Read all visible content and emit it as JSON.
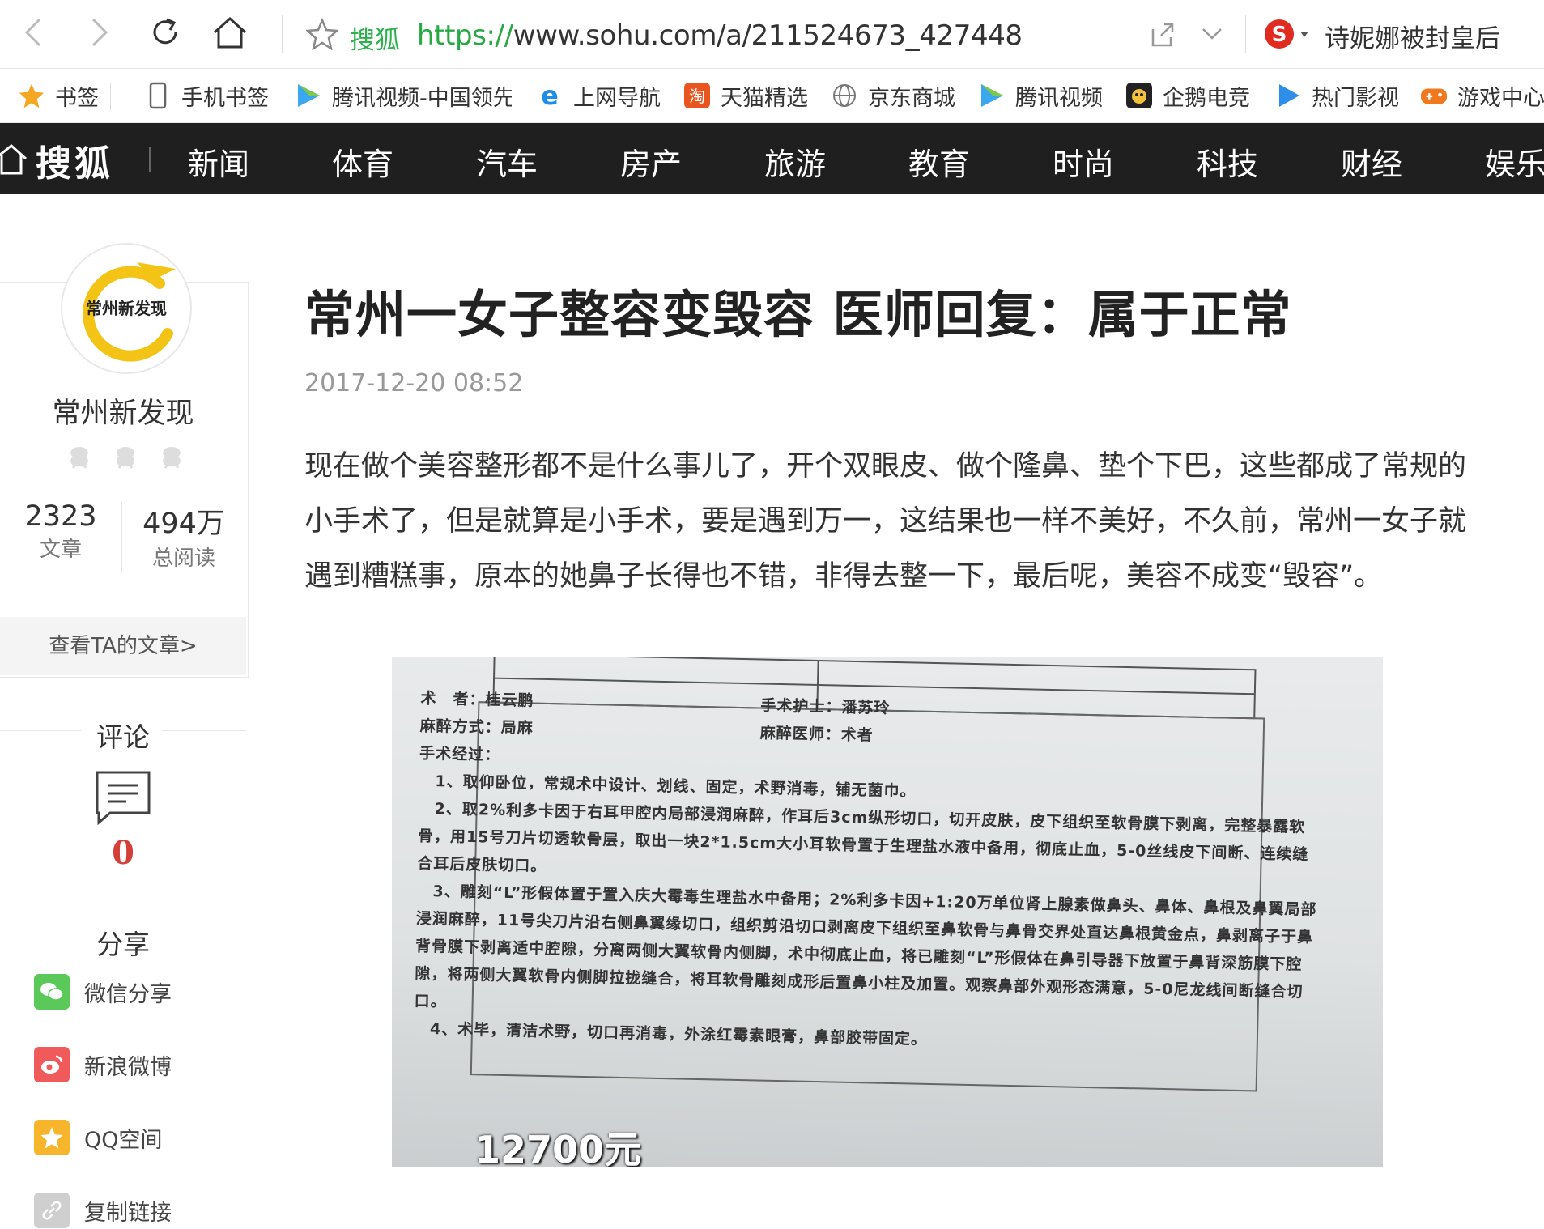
{
  "browser": {
    "site_name": "搜狐",
    "url_protocol": "https://",
    "url_rest": "www.sohu.com/a/211524673_427448",
    "search_hint": "诗妮娜被封皇后"
  },
  "bookmarks": [
    {
      "label": "书签",
      "icon": "star-icon"
    },
    {
      "label": "手机书签",
      "icon": "phone-icon"
    },
    {
      "label": "腾讯视频-中国领先",
      "icon": "play-icon"
    },
    {
      "label": "上网导航",
      "icon": "ie-icon"
    },
    {
      "label": "天猫精选",
      "icon": "tmall-icon"
    },
    {
      "label": "京东商城",
      "icon": "globe-icon"
    },
    {
      "label": "腾讯视频",
      "icon": "play-icon"
    },
    {
      "label": "企鹅电竞",
      "icon": "penguin-icon"
    },
    {
      "label": "热门影视",
      "icon": "play-icon"
    },
    {
      "label": "游戏中心",
      "icon": "gamepad-icon"
    }
  ],
  "sohu_nav": {
    "logo": "搜狐",
    "items": [
      "新闻",
      "体育",
      "汽车",
      "房产",
      "旅游",
      "教育",
      "时尚",
      "科技",
      "财经",
      "娱乐"
    ]
  },
  "author": {
    "avatar_text": "常州新发现",
    "name": "常州新发现",
    "articles_count": "2323",
    "articles_label": "文章",
    "reads_count": "494万",
    "reads_label": "总阅读",
    "view_articles": "查看TA的文章>"
  },
  "comments": {
    "title": "评论",
    "count": "0"
  },
  "share": {
    "title": "分享",
    "items": [
      {
        "label": "微信分享",
        "color": "#5ac95a"
      },
      {
        "label": "新浪微博",
        "color": "#f05a5a"
      },
      {
        "label": "QQ空间",
        "color": "#f7b52c"
      },
      {
        "label": "复制链接",
        "color": "#cfcfcf"
      }
    ]
  },
  "article": {
    "title": "常州一女子整容变毁容 医师回复：属于正常",
    "date": "2017-12-20 08:52",
    "body": "现在做个美容整形都不是什么事儿了，开个双眼皮、做个隆鼻、垫个下巴，这些都成了常规的小手术了，但是就算是小手术，要是遇到万一，这结果也一样不美好，不久前，常州一女子就遇到糟糕事，原本的她鼻子长得也不错，非得去整一下，最后呢，美容不成变“毁容”。",
    "photo_lines": [
      "术　者：桂云鹏　　　　　　　　　　　　　　手术护士：潘苏玲",
      "麻醉方式：局麻　　　　　　　　　　　　　　麻醉医师：术者",
      "手术经过：",
      "　1、取仰卧位，常规术中设计、划线、固定，术野消毒，铺无菌巾。",
      "　2、取2%利多卡因于右耳甲腔内局部浸润麻醉，作耳后3cm纵形切口，切开皮肤，皮下组织至软骨膜下剥离，完整暴露软骨，用15号刀片切透软骨层，取出一块2*1.5cm大小耳软骨置于生理盐水液中备用，彻底止血，5-0丝线皮下间断、连续缝合耳后皮肤切口。",
      "　3、雕刻“L”形假体置于置入庆大霉毒生理盐水中备用；2%利多卡因+1:20万单位肾上腺素做鼻头、鼻体、鼻根及鼻翼局部浸润麻醉，11号尖刀片沿右侧鼻翼缘切口，组织剪沿切口剥离皮下组织至鼻软骨与鼻骨交界处直达鼻根黄金点，鼻剥离子于鼻背骨膜下剥离适中腔隙，分离两侧大翼软骨内侧脚，术中彻底止血，将已雕刻“L”形假体在鼻引导器下放置于鼻背深筋膜下腔隙，将两侧大翼软骨内侧脚拉拢缝合，将耳软骨雕刻成形后置鼻小柱及加置。观察鼻部外观形态满意，5-0尼龙线间断缝合切口。",
      "　4、术毕，清洁术野，切口再消毒，外涂红霉素眼膏，鼻部胶带固定。"
    ],
    "photo_caption": "12700元"
  }
}
